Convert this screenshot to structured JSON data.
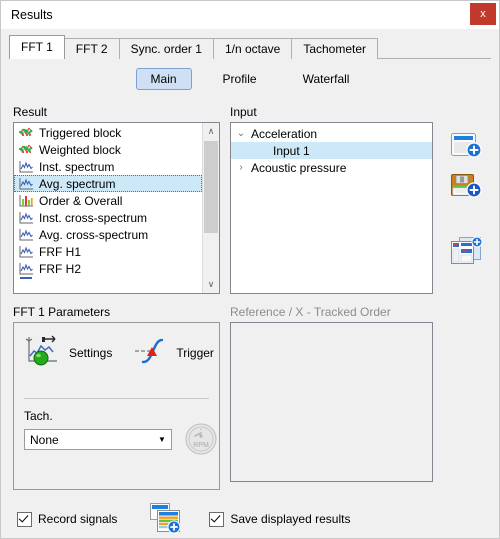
{
  "window": {
    "title": "Results",
    "close_label": "x"
  },
  "tabs": [
    {
      "label": "FFT 1",
      "active": true
    },
    {
      "label": "FFT 2",
      "active": false
    },
    {
      "label": "Sync. order 1",
      "active": false
    },
    {
      "label": "1/n octave",
      "active": false
    },
    {
      "label": "Tachometer",
      "active": false
    }
  ],
  "subtabs": [
    {
      "label": "Main",
      "active": true
    },
    {
      "label": "Profile",
      "active": false
    },
    {
      "label": "Waterfall",
      "active": false
    }
  ],
  "result": {
    "label": "Result",
    "items": [
      {
        "label": "Triggered block",
        "icon": "scatter-block-icon",
        "selected": false
      },
      {
        "label": "Weighted block",
        "icon": "scatter-block-icon",
        "selected": false
      },
      {
        "label": "Inst. spectrum",
        "icon": "spectrum-curve-icon",
        "selected": false
      },
      {
        "label": "Avg. spectrum",
        "icon": "spectrum-curve-icon",
        "selected": true
      },
      {
        "label": "Order & Overall",
        "icon": "bar-chart-icon",
        "selected": false
      },
      {
        "label": "Inst. cross-spectrum",
        "icon": "spectrum-curve-icon",
        "selected": false
      },
      {
        "label": "Avg. cross-spectrum",
        "icon": "spectrum-curve-icon",
        "selected": false
      },
      {
        "label": "FRF H1",
        "icon": "spectrum-curve-icon",
        "selected": false
      },
      {
        "label": "FRF H2",
        "icon": "spectrum-curve-icon",
        "selected": false
      }
    ],
    "scroll_up": "∧",
    "scroll_down": "∨"
  },
  "input": {
    "label": "Input",
    "nodes": [
      {
        "label": "Acceleration",
        "twisty": "⌄",
        "expanded": true,
        "child": false,
        "selected": false
      },
      {
        "label": "Input 1",
        "twisty": "",
        "expanded": false,
        "child": true,
        "selected": true
      },
      {
        "label": "Acoustic pressure",
        "twisty": "›",
        "expanded": false,
        "child": false,
        "selected": false
      }
    ]
  },
  "side_tools": [
    {
      "name": "add-window-icon"
    },
    {
      "name": "save-disk-add-icon"
    },
    {
      "name": "duplicate-layout-icon"
    }
  ],
  "parameters": {
    "label": "FFT 1 Parameters",
    "settings_label": "Settings",
    "trigger_label": "Trigger",
    "tach_label": "Tach.",
    "tach_value": "None",
    "tach_options": [
      "None"
    ],
    "combo_arrow": "▼",
    "rpm_label": "RPM"
  },
  "reference": {
    "label": "Reference / X  -  Tracked Order"
  },
  "bottom": {
    "record_signals": {
      "label": "Record signals",
      "checked": true
    },
    "save_displayed_results": {
      "label": "Save displayed results",
      "checked": true
    },
    "record_icon": "record-setup-icon"
  },
  "colors": {
    "accent": "#cde8f7",
    "title_close": "#c0392b",
    "subtab_active": "#cfe0f5"
  }
}
